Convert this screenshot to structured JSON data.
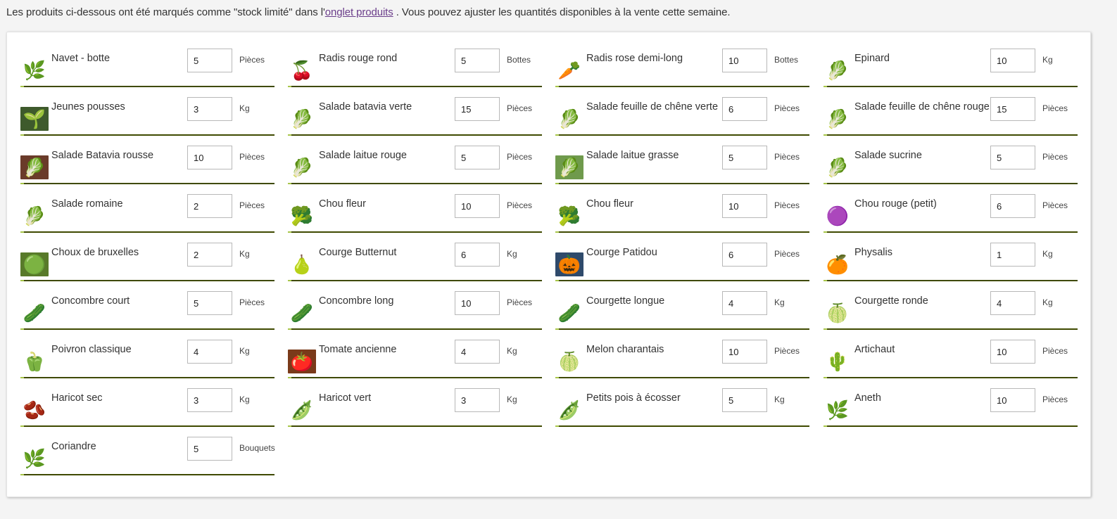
{
  "intro": {
    "before": "Les produits ci-dessous ont été marqués comme \"stock limité\" dans l'",
    "link": "onglet produits",
    "after": ". Vous pouvez ajuster les quantités disponibles à la vente cette semaine."
  },
  "products": [
    {
      "name": "Navet - botte",
      "qty": "5",
      "unit": "Pièces",
      "icon": "turnip-icon",
      "glyph": "🌿",
      "bg": ""
    },
    {
      "name": "Radis rouge rond",
      "qty": "5",
      "unit": "Bottes",
      "icon": "radish-icon",
      "glyph": "🍒",
      "bg": ""
    },
    {
      "name": "Radis rose demi-long",
      "qty": "10",
      "unit": "Bottes",
      "icon": "pink-radish-icon",
      "glyph": "🥕",
      "bg": ""
    },
    {
      "name": "Epinard",
      "qty": "10",
      "unit": "Kg",
      "icon": "spinach-icon",
      "glyph": "🥬",
      "bg": ""
    },
    {
      "name": "Jeunes pousses",
      "qty": "3",
      "unit": "Kg",
      "icon": "young-shoots-icon",
      "glyph": "🌱",
      "bg": "#3e5a2c"
    },
    {
      "name": "Salade batavia verte",
      "qty": "15",
      "unit": "Pièces",
      "icon": "green-lettuce-icon",
      "glyph": "🥬",
      "bg": ""
    },
    {
      "name": "Salade feuille de chêne verte",
      "qty": "6",
      "unit": "Pièces",
      "icon": "oak-leaf-lettuce-icon",
      "glyph": "🥬",
      "bg": ""
    },
    {
      "name": "Salade feuille de chêne rouge",
      "qty": "15",
      "unit": "Pièces",
      "icon": "red-oak-lettuce-icon",
      "glyph": "🥬",
      "bg": ""
    },
    {
      "name": "Salade Batavia rousse",
      "qty": "10",
      "unit": "Pièces",
      "icon": "red-batavia-icon",
      "glyph": "🥬",
      "bg": "#6a3b2a"
    },
    {
      "name": "Salade laitue rouge",
      "qty": "5",
      "unit": "Pièces",
      "icon": "red-lettuce-icon",
      "glyph": "🥬",
      "bg": ""
    },
    {
      "name": "Salade laitue grasse",
      "qty": "5",
      "unit": "Pièces",
      "icon": "butter-lettuce-icon",
      "glyph": "🥬",
      "bg": "#6f9a4c"
    },
    {
      "name": "Salade sucrine",
      "qty": "5",
      "unit": "Pièces",
      "icon": "sucrine-icon",
      "glyph": "🥬",
      "bg": ""
    },
    {
      "name": "Salade romaine",
      "qty": "2",
      "unit": "Pièces",
      "icon": "romaine-icon",
      "glyph": "🥬",
      "bg": ""
    },
    {
      "name": "Chou fleur",
      "qty": "10",
      "unit": "Pièces",
      "icon": "cauliflower-icon",
      "glyph": "🥦",
      "bg": ""
    },
    {
      "name": "Chou fleur",
      "qty": "10",
      "unit": "Pièces",
      "icon": "cauliflower-icon",
      "glyph": "🥦",
      "bg": ""
    },
    {
      "name": "Chou rouge (petit)",
      "qty": "6",
      "unit": "Pièces",
      "icon": "red-cabbage-icon",
      "glyph": "🟣",
      "bg": ""
    },
    {
      "name": "Choux de bruxelles",
      "qty": "2",
      "unit": "Kg",
      "icon": "brussels-sprouts-icon",
      "glyph": "🟢",
      "bg": "#587a2a"
    },
    {
      "name": "Courge Butternut",
      "qty": "6",
      "unit": "Kg",
      "icon": "butternut-icon",
      "glyph": "🍐",
      "bg": ""
    },
    {
      "name": "Courge Patidou",
      "qty": "6",
      "unit": "Pièces",
      "icon": "patidou-squash-icon",
      "glyph": "🎃",
      "bg": "#2f4a6b"
    },
    {
      "name": "Physalis",
      "qty": "1",
      "unit": "Kg",
      "icon": "physalis-icon",
      "glyph": "🍊",
      "bg": ""
    },
    {
      "name": "Concombre court",
      "qty": "5",
      "unit": "Pièces",
      "icon": "short-cucumber-icon",
      "glyph": "🥒",
      "bg": ""
    },
    {
      "name": "Concombre long",
      "qty": "10",
      "unit": "Pièces",
      "icon": "long-cucumber-icon",
      "glyph": "🥒",
      "bg": ""
    },
    {
      "name": "Courgette longue",
      "qty": "4",
      "unit": "Kg",
      "icon": "long-zucchini-icon",
      "glyph": "🥒",
      "bg": ""
    },
    {
      "name": "Courgette ronde",
      "qty": "4",
      "unit": "Kg",
      "icon": "round-zucchini-icon",
      "glyph": "🍈",
      "bg": ""
    },
    {
      "name": "Poivron classique",
      "qty": "4",
      "unit": "Kg",
      "icon": "bell-pepper-icon",
      "glyph": "🫑",
      "bg": ""
    },
    {
      "name": "Tomate ancienne",
      "qty": "4",
      "unit": "Kg",
      "icon": "heirloom-tomato-icon",
      "glyph": "🍅",
      "bg": "#7a3a1a"
    },
    {
      "name": "Melon charantais",
      "qty": "10",
      "unit": "Pièces",
      "icon": "melon-icon",
      "glyph": "🍈",
      "bg": ""
    },
    {
      "name": "Artichaut",
      "qty": "10",
      "unit": "Pièces",
      "icon": "artichoke-icon",
      "glyph": "🌵",
      "bg": ""
    },
    {
      "name": "Haricot sec",
      "qty": "3",
      "unit": "Kg",
      "icon": "dry-bean-icon",
      "glyph": "🫘",
      "bg": ""
    },
    {
      "name": "Haricot vert",
      "qty": "3",
      "unit": "Kg",
      "icon": "green-bean-icon",
      "glyph": "🫛",
      "bg": ""
    },
    {
      "name": "Petits pois à écosser",
      "qty": "5",
      "unit": "Kg",
      "icon": "peas-icon",
      "glyph": "🫛",
      "bg": ""
    },
    {
      "name": "Aneth",
      "qty": "10",
      "unit": "Pièces",
      "icon": "dill-icon",
      "glyph": "🌿",
      "bg": ""
    },
    {
      "name": "Coriandre",
      "qty": "5",
      "unit": "Bouquets",
      "icon": "coriander-icon",
      "glyph": "🌿",
      "bg": ""
    }
  ]
}
